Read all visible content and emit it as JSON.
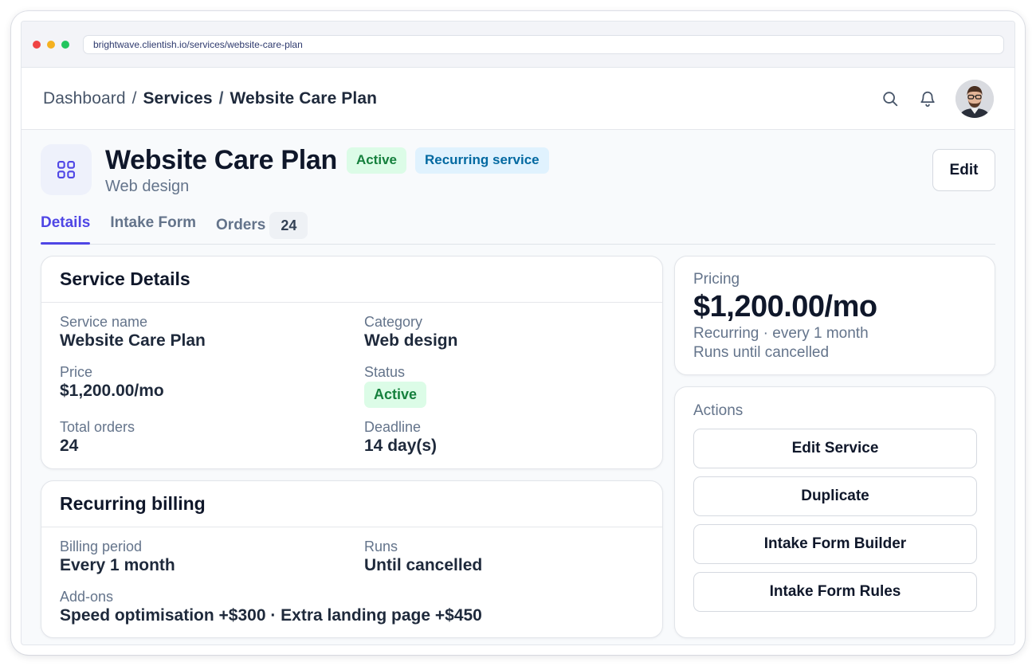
{
  "browser": {
    "url": "brightwave.clientish.io/services/website-care-plan"
  },
  "breadcrumb": {
    "root": "Dashboard",
    "section": "Services",
    "current": "Website Care Plan",
    "separator": "/"
  },
  "header": {
    "title": "Website Care Plan",
    "status_badge": "Active",
    "type_badge": "Recurring service",
    "subtitle": "Web design",
    "edit_label": "Edit"
  },
  "tabs": [
    {
      "label": "Details",
      "active": true
    },
    {
      "label": "Intake Form",
      "active": false
    },
    {
      "label": "Orders",
      "count": "24",
      "active": false
    }
  ],
  "service_details": {
    "heading": "Service Details",
    "fields": {
      "service_name": {
        "label": "Service name",
        "value": "Website Care Plan"
      },
      "category": {
        "label": "Category",
        "value": "Web design"
      },
      "price": {
        "label": "Price",
        "value": "$1,200.00/mo"
      },
      "status": {
        "label": "Status",
        "value": "Active"
      },
      "total_orders": {
        "label": "Total orders",
        "value": "24"
      },
      "deadline": {
        "label": "Deadline",
        "value": "14 day(s)"
      }
    }
  },
  "recurring_billing": {
    "heading": "Recurring billing",
    "fields": {
      "billing_period": {
        "label": "Billing period",
        "value": "Every 1 month"
      },
      "runs": {
        "label": "Runs",
        "value": "Until cancelled"
      },
      "addons": {
        "label": "Add-ons",
        "value": "Speed optimisation +$300 · Extra landing page +$450"
      }
    }
  },
  "pricing": {
    "label": "Pricing",
    "amount": "$1,200.00/mo",
    "recurrence": "Recurring · every 1 month",
    "duration": "Runs until cancelled"
  },
  "actions": {
    "label": "Actions",
    "buttons": [
      "Edit Service",
      "Duplicate",
      "Intake Form Builder",
      "Intake Form Rules"
    ]
  },
  "colors": {
    "accent": "#4f46e5",
    "active_badge_bg": "#dcfce7",
    "active_badge_text": "#15803d",
    "recurring_badge_bg": "#e0f2fe",
    "recurring_badge_text": "#0369a1"
  },
  "icons": {
    "service": "grid-icon",
    "search": "search-icon",
    "notifications": "bell-icon"
  }
}
